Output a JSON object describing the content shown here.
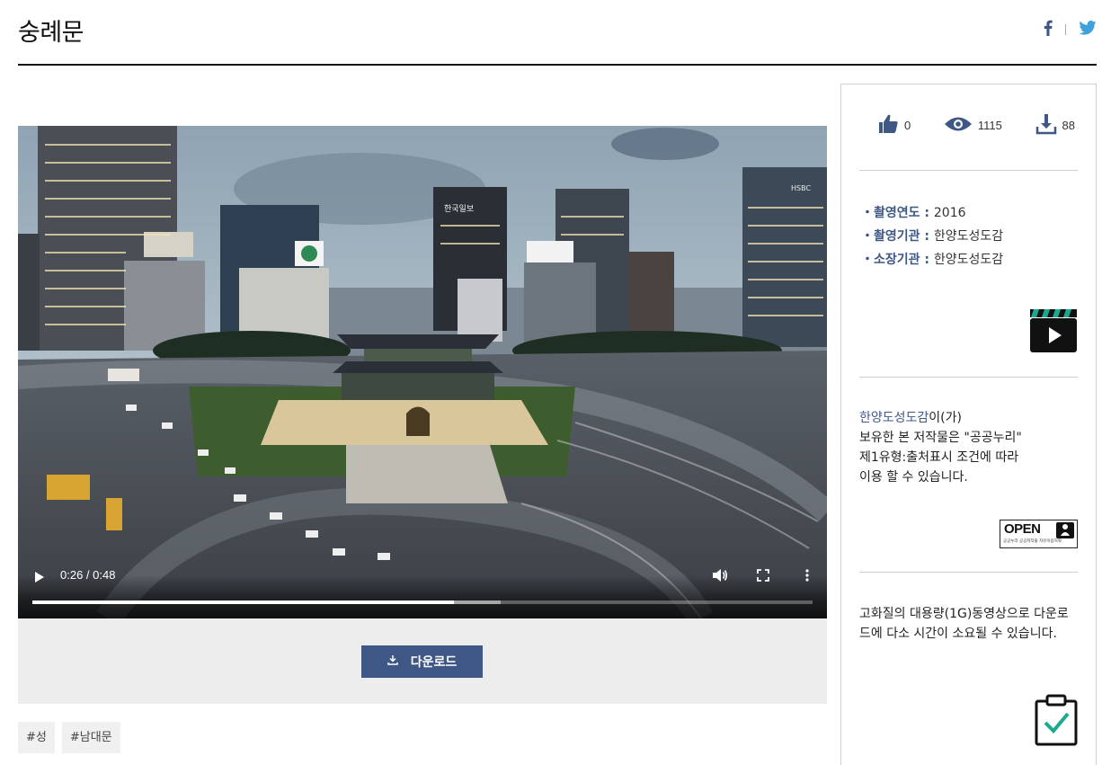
{
  "page": {
    "title": "숭례문"
  },
  "share": {
    "facebook_icon": "facebook-icon",
    "twitter_icon": "twitter-icon"
  },
  "video": {
    "time": "0:26 / 0:48",
    "progress": 0.54,
    "buffered": 0.6,
    "scene_text": {
      "sign1": "한국일보",
      "sign2": "HSBC"
    }
  },
  "download": {
    "label": "다운로드"
  },
  "tags": [
    "#성",
    "#남대문"
  ],
  "stats": {
    "likes": "0",
    "views": "1115",
    "downloads": "88"
  },
  "meta": [
    {
      "key": "촬영연도",
      "value": "2016"
    },
    {
      "key": "촬영기관",
      "value": "한양도성도감"
    },
    {
      "key": "소장기관",
      "value": "한양도성도감"
    }
  ],
  "license": {
    "org": "한양도성도감",
    "suffix": "이(가)",
    "line2": "보유한 본 저작물은 \"공공누리\"",
    "line3": "제1유형:출처표시 조건에 따라",
    "line4": "이용 할 수 있습니다.",
    "badge_text": "OPEN",
    "badge_sub": "공공누리 공공저작물 자유이용허락"
  },
  "note": "고화질의 대용량(1G)동영상으로 다운로드에 다소 시간이 소요될 수 있습니다.",
  "colors": {
    "accent": "#3e5785",
    "panel": "#ededed",
    "check": "#1aaa8f"
  }
}
